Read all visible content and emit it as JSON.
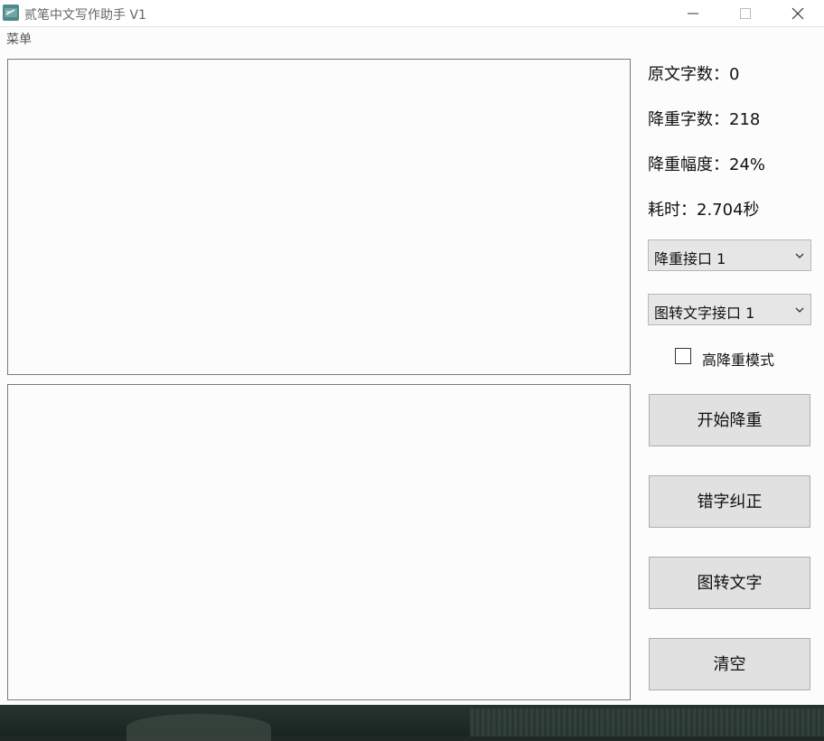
{
  "window": {
    "title": "贰笔中文写作助手 V1",
    "icon": "app-logo-icon",
    "controls": {
      "minimize": "—",
      "maximize": "☐",
      "close": "✕"
    }
  },
  "menubar": {
    "menu_label": "菜单"
  },
  "editors": {
    "source_value": "",
    "result_value": ""
  },
  "stats": {
    "original_count": "原文字数：0",
    "reduced_count": "降重字数：218",
    "reduction_ratio": "降重幅度：24%",
    "elapsed": "耗时：2.704秒"
  },
  "selects": {
    "rewrite_api": "降重接口 1",
    "ocr_api": "图转文字接口 1"
  },
  "options": {
    "high_mode_label": "高降重模式",
    "high_mode_checked": false
  },
  "actions": {
    "start_label": "开始降重",
    "correct_label": "错字纠正",
    "ocr_label": "图转文字",
    "clear_label": "清空"
  },
  "colors": {
    "window_bg": "#fcfcfc",
    "button_bg": "#e1e1e1",
    "icon_accent": "#4f8a8b"
  }
}
